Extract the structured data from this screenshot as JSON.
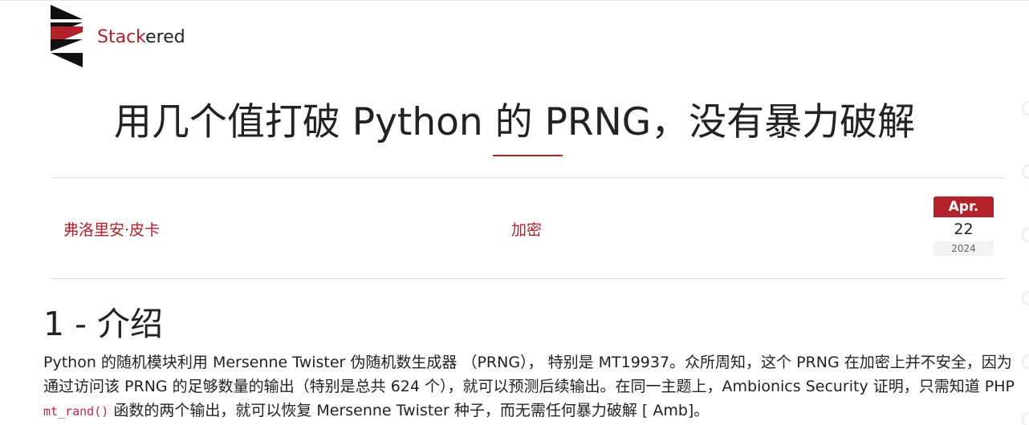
{
  "site": {
    "brand_prefix": "Stack",
    "brand_suffix": "ered"
  },
  "post": {
    "title": "用几个值打破 Python 的 PRNG，没有暴力破解",
    "author": "弗洛里安·皮卡",
    "category": "加密",
    "date": {
      "month": "Apr.",
      "day": "22",
      "year": "2024"
    }
  },
  "section": {
    "heading": "1 - 介绍",
    "para_part1": "Python 的随机模块利用 Mersenne Twister 伪随机数生成器 （PRNG）， 特别是 MT19937。众所周知，这个 PRNG 在加密上并不安全，因为通过访问该 PRNG 的足够数量的输出（特别是总共 624 个），就可以预测后续输出。在同一主题上，Ambionics Security 证明，只需知道 PHP ",
    "code": "mt_rand()",
    "para_part2": " 函数的两个输出，就可以恢复 Mersenne Twister 种子，而无需任何暴力破解 [ Amb]。"
  },
  "colors": {
    "accent": "#b3212b",
    "text": "#222222",
    "divider": "#dedede"
  }
}
